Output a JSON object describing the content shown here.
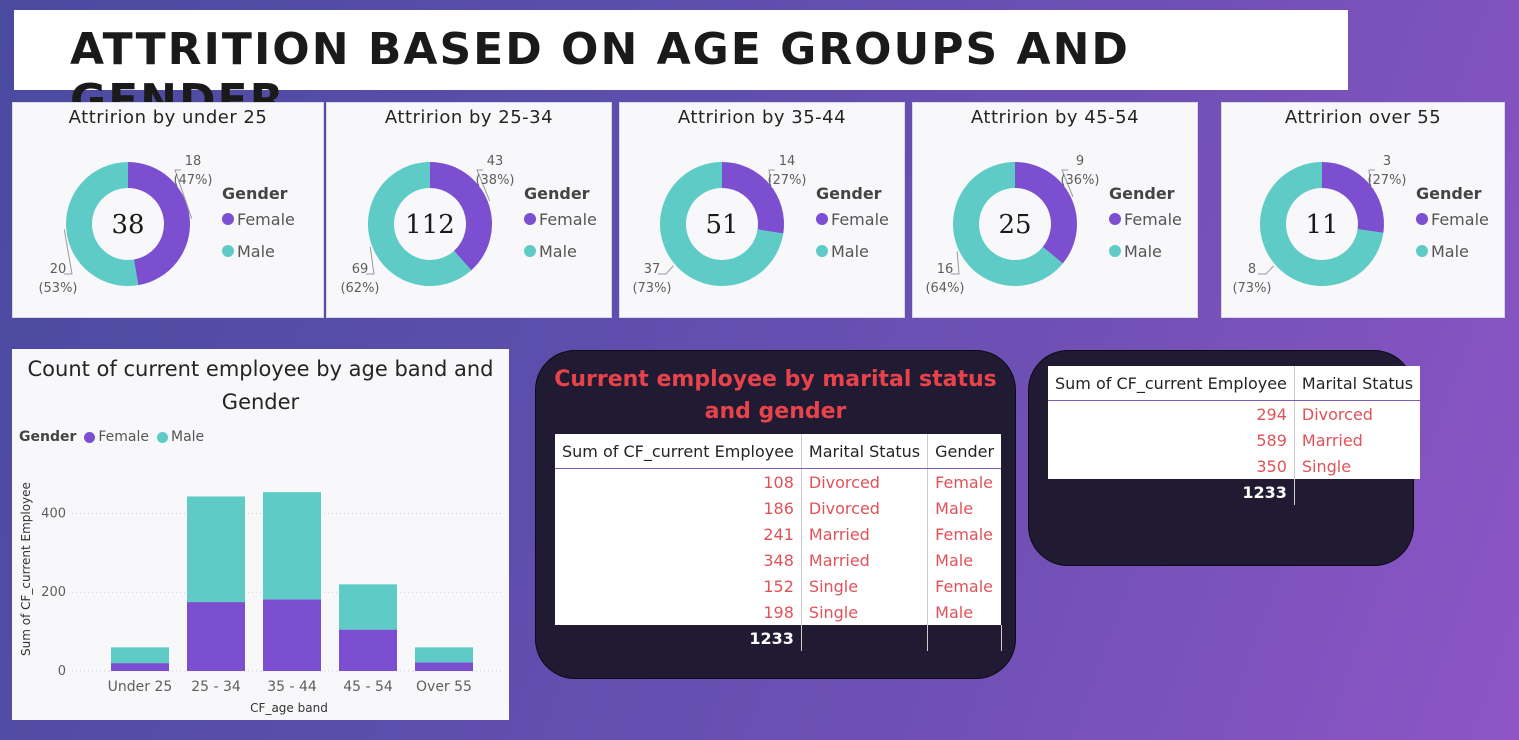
{
  "page_title": "ATTRITION BASED ON AGE GROUPS AND GENDER",
  "colors": {
    "female": "#7c4fd0",
    "male": "#5ecbc7"
  },
  "legend": {
    "title": "Gender",
    "female": "Female",
    "male": "Male"
  },
  "donuts": [
    {
      "title": "Attririon by under 25",
      "total": "38",
      "female": 18,
      "male": 20,
      "female_label": "18",
      "female_pct": "(47%)",
      "male_label": "20",
      "male_pct": "(53%)"
    },
    {
      "title": "Attririon by 25-34",
      "total": "112",
      "female": 43,
      "male": 69,
      "female_label": "43",
      "female_pct": "(38%)",
      "male_label": "69",
      "male_pct": "(62%)"
    },
    {
      "title": "Attririon by 35-44",
      "total": "51",
      "female": 14,
      "male": 37,
      "female_label": "14",
      "female_pct": "(27%)",
      "male_label": "37",
      "male_pct": "(73%)"
    },
    {
      "title": "Attririon by 45-54",
      "total": "25",
      "female": 9,
      "male": 16,
      "female_label": "9",
      "female_pct": "(36%)",
      "male_label": "16",
      "male_pct": "(64%)"
    },
    {
      "title": "Attririon over 55",
      "total": "11",
      "female": 3,
      "male": 8,
      "female_label": "3",
      "female_pct": "(27%)",
      "male_label": "8",
      "male_pct": "(73%)"
    }
  ],
  "chart_data": {
    "type": "bar",
    "stacked": true,
    "title": "Count of current employee by age band and Gender",
    "xlabel": "CF_age band",
    "ylabel": "Sum of CF_current Employee",
    "categories": [
      "Under 25",
      "25 - 34",
      "35 - 44",
      "45 - 54",
      "Over 55"
    ],
    "series": [
      {
        "name": "Female",
        "values": [
          20,
          175,
          182,
          105,
          22
        ]
      },
      {
        "name": "Male",
        "values": [
          40,
          268,
          272,
          115,
          38
        ]
      }
    ],
    "yticks": [
      "0",
      "200",
      "400"
    ],
    "ylim": [
      0,
      500
    ],
    "legend_title": "Gender"
  },
  "table1": {
    "title": "Current employee by marital status and gender",
    "headers": [
      "Sum of CF_current Employee",
      "Marital Status",
      "Gender"
    ],
    "rows": [
      [
        "108",
        "Divorced",
        "Female"
      ],
      [
        "186",
        "Divorced",
        "Male"
      ],
      [
        "241",
        "Married",
        "Female"
      ],
      [
        "348",
        "Married",
        "Male"
      ],
      [
        "152",
        "Single",
        "Female"
      ],
      [
        "198",
        "Single",
        "Male"
      ]
    ],
    "total": "1233"
  },
  "table2": {
    "headers": [
      "Sum of CF_current Employee",
      "Marital Status"
    ],
    "rows": [
      [
        "294",
        "Divorced"
      ],
      [
        "589",
        "Married"
      ],
      [
        "350",
        "Single"
      ]
    ],
    "total": "1233"
  }
}
